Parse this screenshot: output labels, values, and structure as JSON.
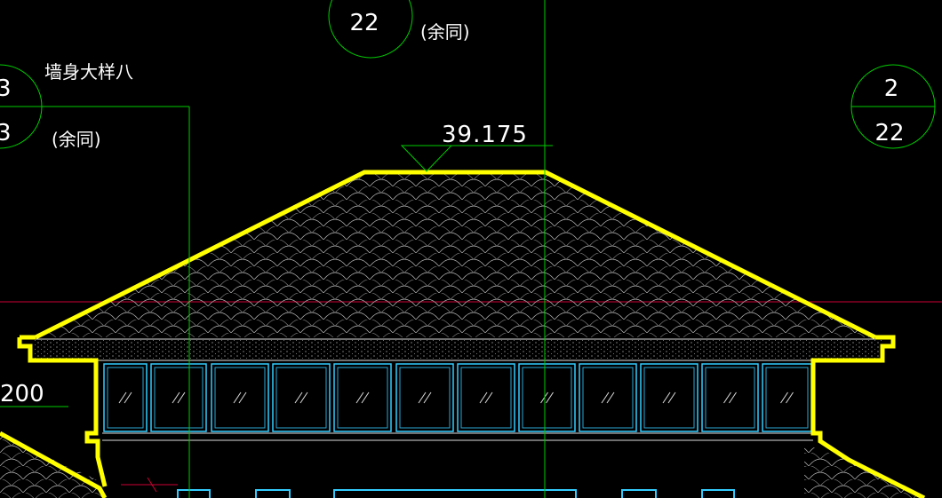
{
  "drawing": {
    "elevation_label": "39.175",
    "dim_label": "200",
    "note_left": "墙身大样八",
    "note_same_left": "(余同)",
    "note_same_top": "(余同)",
    "callout_top": {
      "bottom": "22"
    },
    "callout_left": {
      "top": "3",
      "bottom": "3"
    },
    "callout_right": {
      "top": "2",
      "bottom": "22"
    }
  },
  "colors": {
    "background": "#000000",
    "roof_outline": "#ffff00",
    "grid_line": "#00cc00",
    "window_frame": "#33ccff",
    "axis_line": "#cc0033",
    "text": "#ffffff"
  }
}
